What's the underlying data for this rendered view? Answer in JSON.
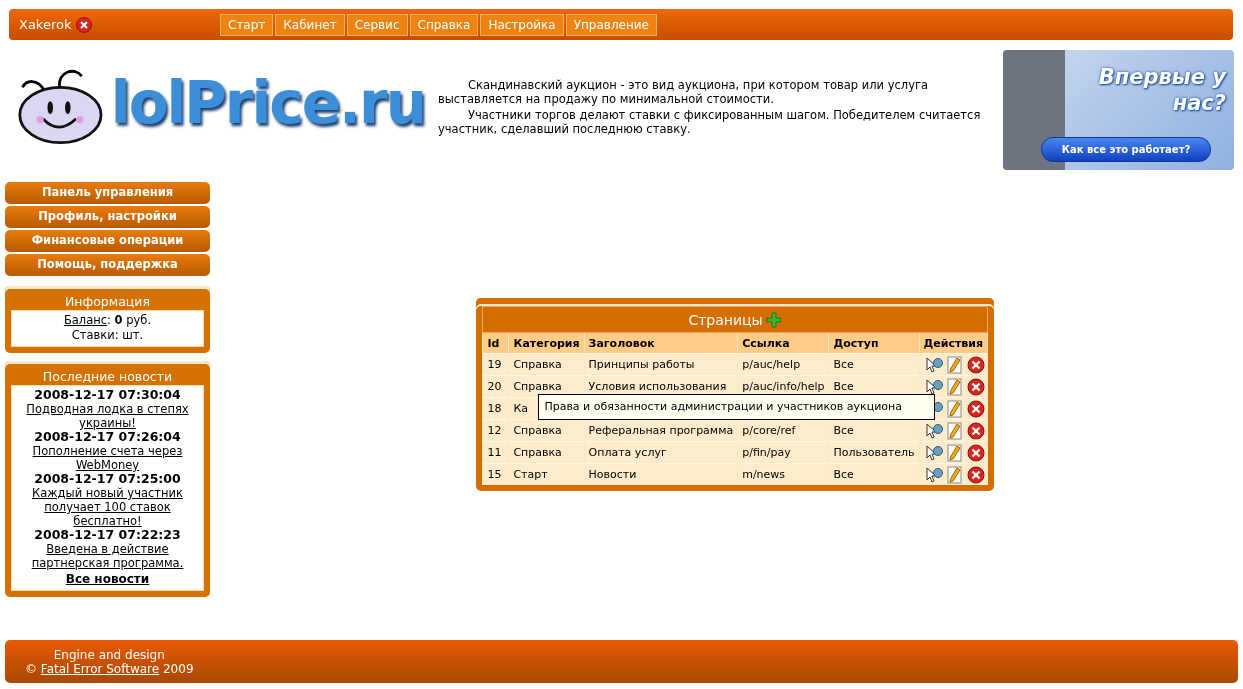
{
  "top_bar": {
    "username": "Xakerok",
    "menu": [
      "Старт",
      "Кабинет",
      "Сервис",
      "Справка",
      "Настройка",
      "Управление"
    ]
  },
  "header": {
    "logo": "lolPrice.ru",
    "intro": [
      "Скандинавский аукцион - это вид аукциона, при котором товар или услуга выставляется на продажу по минимальной стоимости.",
      "Участники торгов делают ставки с фиксированным шагом. Победителем считается участник, сделавший последнюю ставку."
    ],
    "banner": {
      "title": "Впервые у нас?",
      "button": "Как все это работает?"
    }
  },
  "sidebar": {
    "menu": [
      "Панель управления",
      "Профиль, настройки",
      "Финансовые операции",
      "Помощь, поддержка"
    ],
    "info": {
      "title": "Информация",
      "balance_link": "Баланс",
      "balance_rest": ": **0** руб.",
      "bids": "Ставки: шт."
    },
    "news": {
      "title": "Последние новости",
      "items": [
        {
          "date": "2008-12-17 07:30:04",
          "title": "Подводная лодка в степях украины!"
        },
        {
          "date": "2008-12-17 07:26:04",
          "title": "Пополнение счета через WebMoney"
        },
        {
          "date": "2008-12-17 07:25:00",
          "title": "Каждый новый участник получает 100 ставок бесплатно!"
        },
        {
          "date": "2008-12-17 07:22:23",
          "title": "Введена в действие партнерская программа."
        }
      ],
      "all_link": "Все новости"
    }
  },
  "pages_table": {
    "title": "Страницы",
    "columns": [
      "Id",
      "Категория",
      "Заголовок",
      "Ссылка",
      "Доступ",
      "Действия"
    ],
    "rows": [
      {
        "cells": [
          "19",
          "Справка",
          "Принципы работы",
          "p/auc/help",
          "Все"
        ]
      },
      {
        "cells": [
          "20",
          "Справка",
          "Условия использования",
          "p/auc/info/help",
          "Все"
        ]
      },
      {
        "cells": [
          "18",
          "Ка"
        ]
      },
      {
        "cells": [
          "12",
          "Справка",
          "Реферальная программа",
          "p/core/ref",
          "Все"
        ]
      },
      {
        "cells": [
          "11",
          "Справка",
          "Оплата услуг",
          "p/fin/pay",
          "Пользователь"
        ]
      },
      {
        "cells": [
          "15",
          "Старт",
          "Новости",
          "m/news",
          "Все"
        ]
      }
    ],
    "tooltip": {
      "text": "Права и обязанности администрации и участников аукциона"
    }
  },
  "footer": {
    "line1": "Engine and design",
    "copyright": "©",
    "link": "Fatal Error Software",
    "year": "2009"
  }
}
